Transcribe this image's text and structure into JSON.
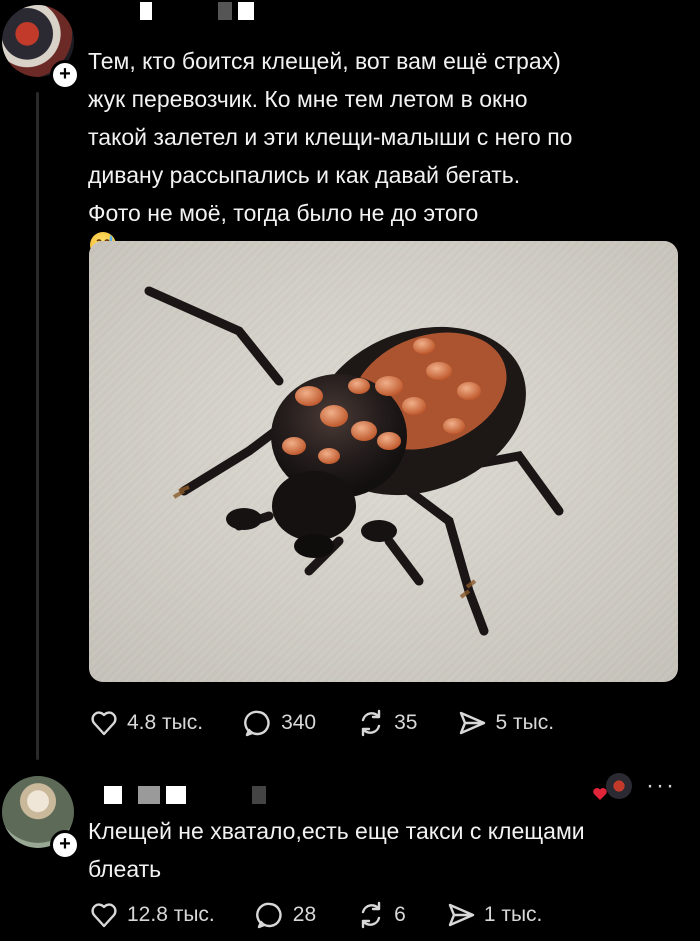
{
  "post": {
    "lines": [
      "Тем, кто боится клещей, вот вам ещё страх)",
      "жук перевозчик. Ко мне тем летом в окно",
      "такой залетел и эти клещи-малыши с него по",
      "дивану рассыпались и как давай бегать.",
      "Фото не моё, тогда было не до этого"
    ],
    "emoji": "sweat-smile-emoji",
    "image_alt": "Жук-перевозчик с клещами на ткани",
    "likes": "4.8 тыс.",
    "replies": "340",
    "reposts": "35",
    "shares": "5 тыс."
  },
  "comment": {
    "lines": [
      "Клещей не хватало,есть еще такси с клещами",
      "блеать"
    ],
    "likes": "12.8 тыс.",
    "replies": "28",
    "reposts": "6",
    "shares": "1 тыс."
  },
  "icons": {
    "follow": "+",
    "more": "···"
  },
  "colors": {
    "background": "#000000",
    "text": "#f2f2f2",
    "muted": "#d8d8d8",
    "like_red": "#e0243a"
  }
}
